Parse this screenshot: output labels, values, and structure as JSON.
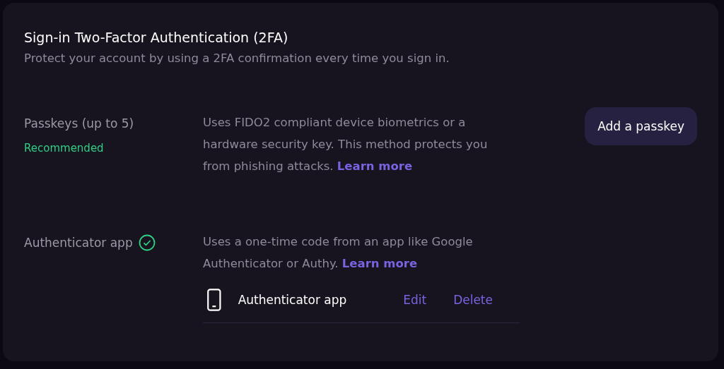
{
  "section": {
    "title": "Sign-in Two-Factor Authentication (2FA)",
    "subtitle": "Protect your account by using a 2FA confirmation every time you sign in."
  },
  "methods": [
    {
      "name": "Passkeys (up to 5)",
      "badge": "Recommended",
      "verified": false,
      "description": "Uses FIDO2 compliant device biometrics or a hardware security key. This method protects you from phishing attacks.",
      "link": "Learn more",
      "button": "Add a passkey"
    },
    {
      "name": "Authenticator app",
      "verified": true,
      "description": "Uses a one-time code from an app like Google Authenticator or Authy.",
      "link": "Learn more",
      "devices": [
        {
          "name": "Authenticator app",
          "actions": [
            "Edit",
            "Delete"
          ]
        }
      ]
    }
  ]
}
